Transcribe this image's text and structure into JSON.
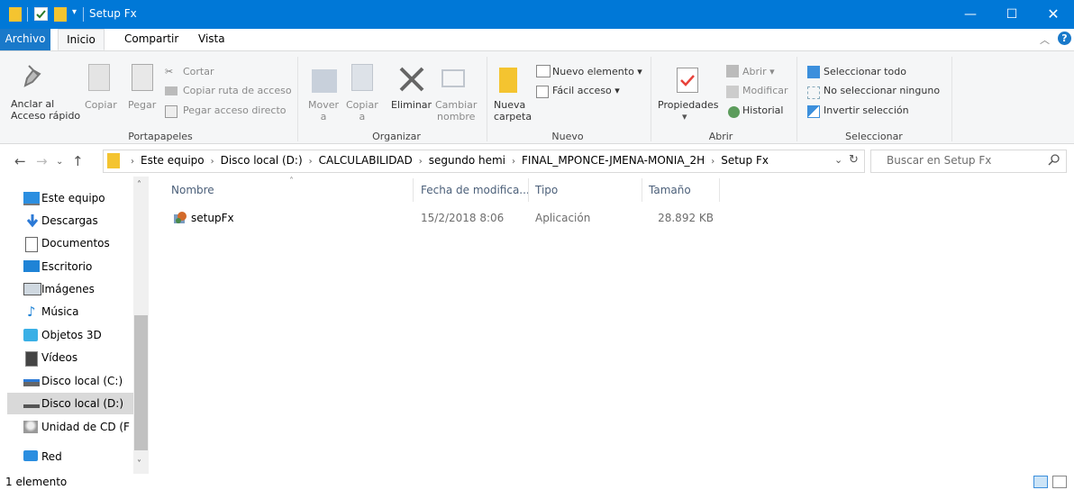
{
  "window": {
    "title": "Setup Fx"
  },
  "tabs": [
    {
      "label": "Archivo"
    },
    {
      "label": "Inicio"
    },
    {
      "label": "Compartir"
    },
    {
      "label": "Vista"
    }
  ],
  "ribbon": {
    "portapapeles": {
      "pin_label_1": "Anclar al",
      "pin_label_2": "Acceso rápido",
      "copy": "Copiar",
      "paste": "Pegar",
      "cut": "Cortar",
      "copy_path": "Copiar ruta de acceso",
      "paste_shortcut": "Pegar acceso directo",
      "group": "Portapapeles"
    },
    "organizar": {
      "move_1": "Mover",
      "move_2": "a",
      "copy_1": "Copiar",
      "copy_2": "a",
      "delete": "Eliminar",
      "rename_1": "Cambiar",
      "rename_2": "nombre",
      "group": "Organizar"
    },
    "nuevo": {
      "new_folder_1": "Nueva",
      "new_folder_2": "carpeta",
      "new_item": "Nuevo elemento",
      "easy_access": "Fácil acceso",
      "group": "Nuevo"
    },
    "abrir": {
      "properties": "Propiedades",
      "open": "Abrir",
      "edit": "Modificar",
      "history": "Historial",
      "group": "Abrir"
    },
    "seleccionar": {
      "select_all": "Seleccionar todo",
      "select_none": "No seleccionar ninguno",
      "invert": "Invertir selección",
      "group": "Seleccionar"
    }
  },
  "address": {
    "breadcrumbs": [
      "Este equipo",
      "Disco local (D:)",
      "CALCULABILIDAD",
      "segundo hemi",
      "FINAL_MPONCE-JMENA-MONIA_2H",
      "Setup Fx"
    ],
    "search_placeholder": "Buscar en Setup Fx"
  },
  "navpane": [
    {
      "label": "Este equipo",
      "icon": "computer-icon"
    },
    {
      "label": "Descargas",
      "icon": "download-icon"
    },
    {
      "label": "Documentos",
      "icon": "documents-icon"
    },
    {
      "label": "Escritorio",
      "icon": "desktop-icon"
    },
    {
      "label": "Imágenes",
      "icon": "pictures-icon"
    },
    {
      "label": "Música",
      "icon": "music-icon"
    },
    {
      "label": "Objetos 3D",
      "icon": "3d-objects-icon"
    },
    {
      "label": "Vídeos",
      "icon": "videos-icon"
    },
    {
      "label": "Disco local (C:)",
      "icon": "drive-icon"
    },
    {
      "label": "Disco local (D:)",
      "icon": "drive-icon"
    },
    {
      "label": "Unidad de CD (F",
      "icon": "cd-drive-icon"
    },
    {
      "label": "Red",
      "icon": "network-icon"
    }
  ],
  "columns": [
    "Nombre",
    "Fecha de modifica...",
    "Tipo",
    "Tamaño"
  ],
  "files": [
    {
      "name": "setupFx",
      "date": "15/2/2018 8:06",
      "type": "Aplicación",
      "size": "28.892 KB"
    }
  ],
  "status": {
    "count": "1 elemento"
  },
  "colors": {
    "titlebar": "#0078d7",
    "archivo_tab": "#1979ca",
    "selection": "#d9d9d9"
  }
}
